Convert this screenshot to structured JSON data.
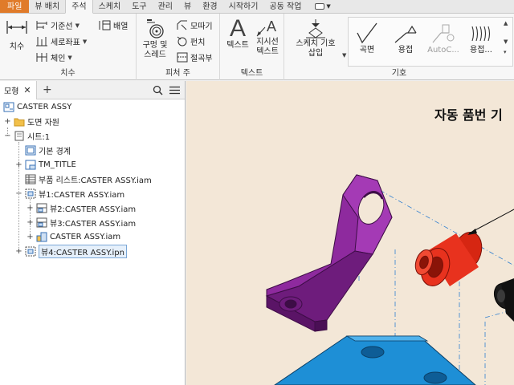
{
  "menu_tabs": [
    "파일",
    "뷰 배치",
    "주석",
    "스케치",
    "도구",
    "관리",
    "뷰",
    "환경",
    "시작하기",
    "공동 작업"
  ],
  "active_tab": "주석",
  "ribbon": {
    "dimension": {
      "group_label": "치수",
      "dimension_btn": "치수",
      "baseline": "기준선",
      "ordinate": "세로좌표",
      "chain": "체인",
      "arrange": "배열"
    },
    "feature_notes": {
      "group_label": "피처 주",
      "hole_thread_line1": "구멍 및",
      "hole_thread_line2": "스레드",
      "chamfer": "모따기",
      "punch": "펀치",
      "bend": "절곡부"
    },
    "text": {
      "group_label": "텍스트",
      "text_btn": "텍스트",
      "leader_line1": "지시선",
      "leader_line2": "텍스트"
    },
    "symbols": {
      "group_label": "기호",
      "sketch_symbol_line1": "스케치 기호",
      "sketch_symbol_line2": "삽입",
      "surface": "곡면",
      "weld": "용접",
      "autoc": "AutoC...",
      "weld2": "용접..."
    }
  },
  "browser": {
    "tab_label": "모형",
    "tree": [
      {
        "label": "CASTER ASSY",
        "icon": "drawing-icon"
      },
      {
        "label": "도면 자원",
        "icon": "folder-icon"
      },
      {
        "label": "시트:1",
        "icon": "sheet-icon"
      },
      {
        "label": "기본 경계",
        "icon": "border-icon"
      },
      {
        "label": "TM_TITLE",
        "icon": "title-block-icon"
      },
      {
        "label": "부품 리스트:CASTER ASSY.iam",
        "icon": "parts-list-icon"
      },
      {
        "label": "뷰1:CASTER ASSY.iam",
        "icon": "view-icon"
      },
      {
        "label": "뷰2:CASTER ASSY.iam",
        "icon": "view-icon"
      },
      {
        "label": "뷰3:CASTER ASSY.iam",
        "icon": "view-icon"
      },
      {
        "label": "CASTER ASSY.iam",
        "icon": "assembly-icon"
      },
      {
        "label": "뷰4:CASTER ASSY.ipn",
        "icon": "view-icon"
      }
    ]
  },
  "canvas": {
    "sheet_title": "자동 품번 기"
  },
  "colors": {
    "file_tab": "#e07b2a",
    "canvas_bg": "#f3e7d7",
    "bracket_part": "#8e2a9e",
    "bushing_part": "#e8321e",
    "base_part": "#1e8fd6",
    "selection": "#7aa7d6"
  }
}
